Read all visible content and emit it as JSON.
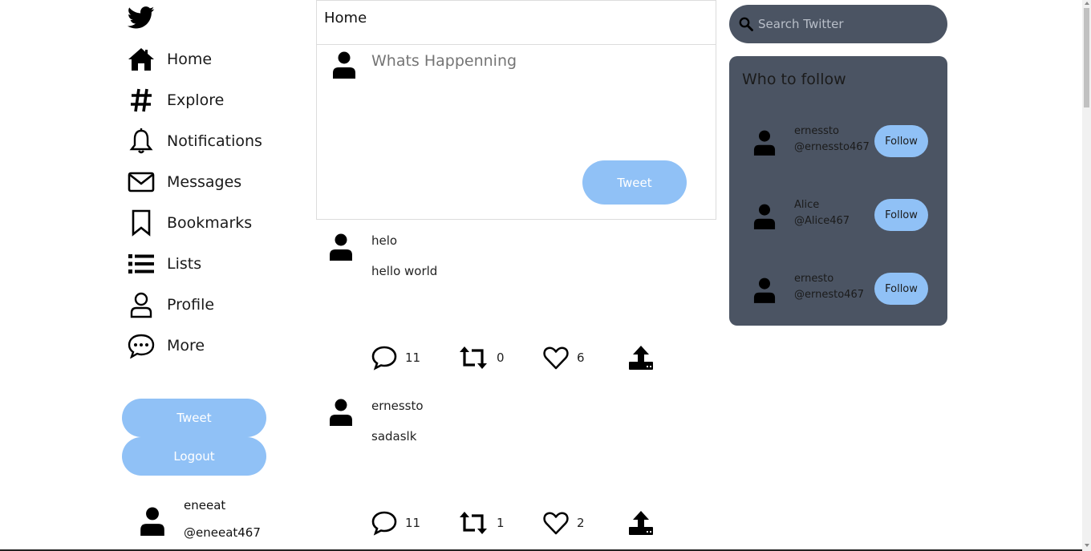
{
  "nav": {
    "items": [
      {
        "label": "Home",
        "icon": "home-icon"
      },
      {
        "label": "Explore",
        "icon": "hashtag-icon"
      },
      {
        "label": "Notifications",
        "icon": "bell-icon"
      },
      {
        "label": "Messages",
        "icon": "envelope-icon"
      },
      {
        "label": "Bookmarks",
        "icon": "bookmark-icon"
      },
      {
        "label": "Lists",
        "icon": "list-icon"
      },
      {
        "label": "Profile",
        "icon": "user-icon"
      },
      {
        "label": "More",
        "icon": "more-bubble-icon"
      }
    ],
    "tweet_button": "Tweet",
    "logout_button": "Logout",
    "current_user": {
      "name": "eneeat",
      "handle": "@eneeat467"
    }
  },
  "header": {
    "title": "Home"
  },
  "composer": {
    "placeholder": "Whats Happenning",
    "tweet_button": "Tweet"
  },
  "feed": [
    {
      "author": "helo",
      "text": "hello world",
      "replies": "11",
      "retweets": "0",
      "likes": "6"
    },
    {
      "author": "ernessto",
      "text": "sadaslk",
      "replies": "11",
      "retweets": "1",
      "likes": "2"
    }
  ],
  "search": {
    "placeholder": "Search Twitter"
  },
  "who_to_follow": {
    "title": "Who to follow",
    "follow_label": "Follow",
    "users": [
      {
        "name": "ernessto",
        "handle": "@ernessto467"
      },
      {
        "name": "Alice",
        "handle": "@Alice467"
      },
      {
        "name": "ernesto",
        "handle": "@ernesto467"
      }
    ]
  },
  "colors": {
    "accent_button": "#90c1f6",
    "right_panel": "#4b5463",
    "border": "#dcdcdc",
    "icon": "#000000"
  }
}
